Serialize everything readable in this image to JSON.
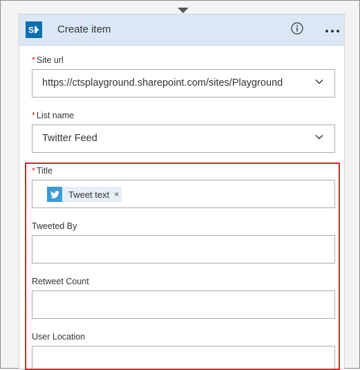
{
  "card": {
    "title": "Create item",
    "connector_icon": "sharepoint-icon",
    "info_icon": "info-icon",
    "menu_icon": "more-icon"
  },
  "fields": {
    "site_url": {
      "label": "Site url",
      "required_marker": "*",
      "value": "https://ctsplayground.sharepoint.com/sites/Playground"
    },
    "list_name": {
      "label": "List name",
      "required_marker": "*",
      "value": "Twitter Feed"
    },
    "title": {
      "label": "Title",
      "required_marker": "*",
      "token_label": "Tweet text",
      "token_close": "×",
      "token_icon": "twitter-icon"
    },
    "tweeted_by": {
      "label": "Tweeted By",
      "value": ""
    },
    "retweet_count": {
      "label": "Retweet Count",
      "value": ""
    },
    "user_location": {
      "label": "User Location",
      "value": ""
    }
  },
  "colors": {
    "header_bg": "#dae8f5",
    "sharepoint_blue": "#0a6faf",
    "twitter_blue": "#3c9bd6",
    "highlight_red": "#d9202d",
    "required_red": "#e02020"
  }
}
